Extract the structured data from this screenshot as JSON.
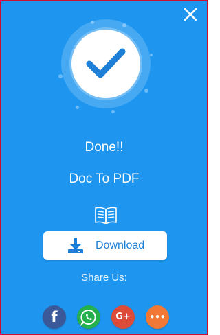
{
  "dialog": {
    "title": "Done!!",
    "file_name": "Doc To PDF",
    "download_label": "Download",
    "share_label": "Share Us:"
  },
  "share": [
    {
      "name": "facebook",
      "glyph": "f",
      "color": "#3b5998"
    },
    {
      "name": "whatsapp",
      "glyph": "",
      "color": "#25b04e"
    },
    {
      "name": "google-plus",
      "glyph": "G+",
      "color": "#dd4b39"
    },
    {
      "name": "more",
      "glyph": "•••",
      "color": "#f27935"
    }
  ],
  "colors": {
    "background": "#1e96f0",
    "accent": "#1e7fd6"
  },
  "icons": {
    "close": "close-icon",
    "check": "checkmark-icon",
    "book": "open-book-icon",
    "download": "download-icon"
  }
}
